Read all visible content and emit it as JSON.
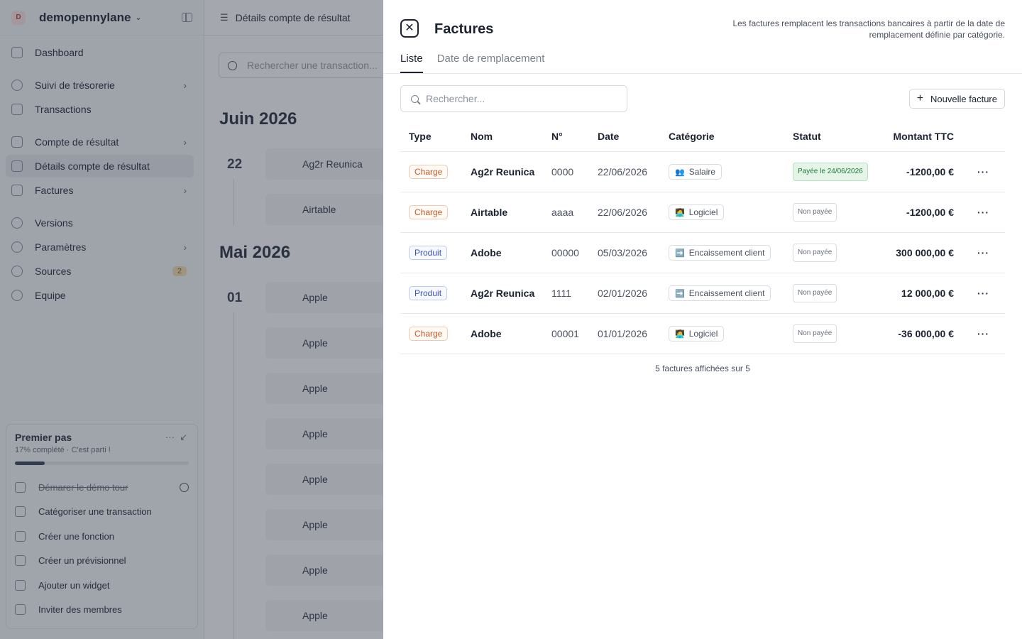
{
  "sidebar": {
    "workspace_initial": "D",
    "workspace_name": "demopennylane",
    "items": [
      {
        "label": "Dashboard"
      },
      {
        "label": "Suivi de trésorerie"
      },
      {
        "label": "Transactions"
      },
      {
        "label": "Compte de résultat"
      },
      {
        "label": "Détails compte de résultat"
      },
      {
        "label": "Factures"
      },
      {
        "label": "Versions"
      },
      {
        "label": "Paramètres"
      },
      {
        "label": "Sources",
        "badge": "2"
      },
      {
        "label": "Equipe"
      }
    ],
    "onboarding": {
      "title": "Premier pas",
      "subtitle": "17% complété · C'est parti !",
      "progress_percent": 17,
      "steps": [
        {
          "label": "Démarer le démo tour"
        },
        {
          "label": "Catégoriser une transaction"
        },
        {
          "label": "Créer une fonction"
        },
        {
          "label": "Créer un prévisionnel"
        },
        {
          "label": "Ajouter un widget"
        },
        {
          "label": "Inviter des membres"
        }
      ]
    }
  },
  "main": {
    "breadcrumb": "Détails compte de résultat",
    "search_placeholder": "Rechercher une transaction...",
    "months": [
      {
        "label": "Juin 2026",
        "day": "22",
        "transactions": [
          "Ag2r Reunica",
          "Airtable"
        ]
      },
      {
        "label": "Mai 2026",
        "day": "01",
        "transactions": [
          "Apple",
          "Apple",
          "Apple",
          "Apple",
          "Apple",
          "Apple",
          "Apple",
          "Apple"
        ]
      }
    ]
  },
  "drawer": {
    "title": "Factures",
    "note": "Les factures remplacent les transactions bancaires à partir de la date de remplacement définie par catégorie.",
    "tabs": [
      {
        "label": "Liste"
      },
      {
        "label": "Date de remplacement"
      }
    ],
    "search_placeholder": "Rechercher...",
    "new_button_label": "Nouvelle facture",
    "columns": {
      "type": "Type",
      "nom": "Nom",
      "num": "N°",
      "date": "Date",
      "categorie": "Catégorie",
      "statut": "Statut",
      "montant": "Montant TTC"
    },
    "rows": [
      {
        "type": "Charge",
        "nom": "Ag2r Reunica",
        "num": "0000",
        "date": "22/06/2026",
        "categorie": "Salaire",
        "cat_emoji": "👥",
        "statut": "Payée le 24/06/2026",
        "montant": "-1200,00 €"
      },
      {
        "type": "Charge",
        "nom": "Airtable",
        "num": "aaaa",
        "date": "22/06/2026",
        "categorie": "Logiciel",
        "cat_emoji": "🧑‍💻",
        "statut": "Non payée",
        "montant": "-1200,00 €"
      },
      {
        "type": "Produit",
        "nom": "Adobe",
        "num": "00000",
        "date": "05/03/2026",
        "categorie": "Encaissement client",
        "cat_emoji": "➡️",
        "statut": "Non payée",
        "montant": "300 000,00 €"
      },
      {
        "type": "Produit",
        "nom": "Ag2r Reunica",
        "num": "1111",
        "date": "02/01/2026",
        "categorie": "Encaissement client",
        "cat_emoji": "➡️",
        "statut": "Non payée",
        "montant": "12 000,00 €"
      },
      {
        "type": "Charge",
        "nom": "Adobe",
        "num": "00001",
        "date": "01/01/2026",
        "categorie": "Logiciel",
        "cat_emoji": "🧑‍💻",
        "statut": "Non payée",
        "montant": "-36 000,00 €"
      }
    ],
    "footer_count": "5 factures affichées sur 5"
  }
}
